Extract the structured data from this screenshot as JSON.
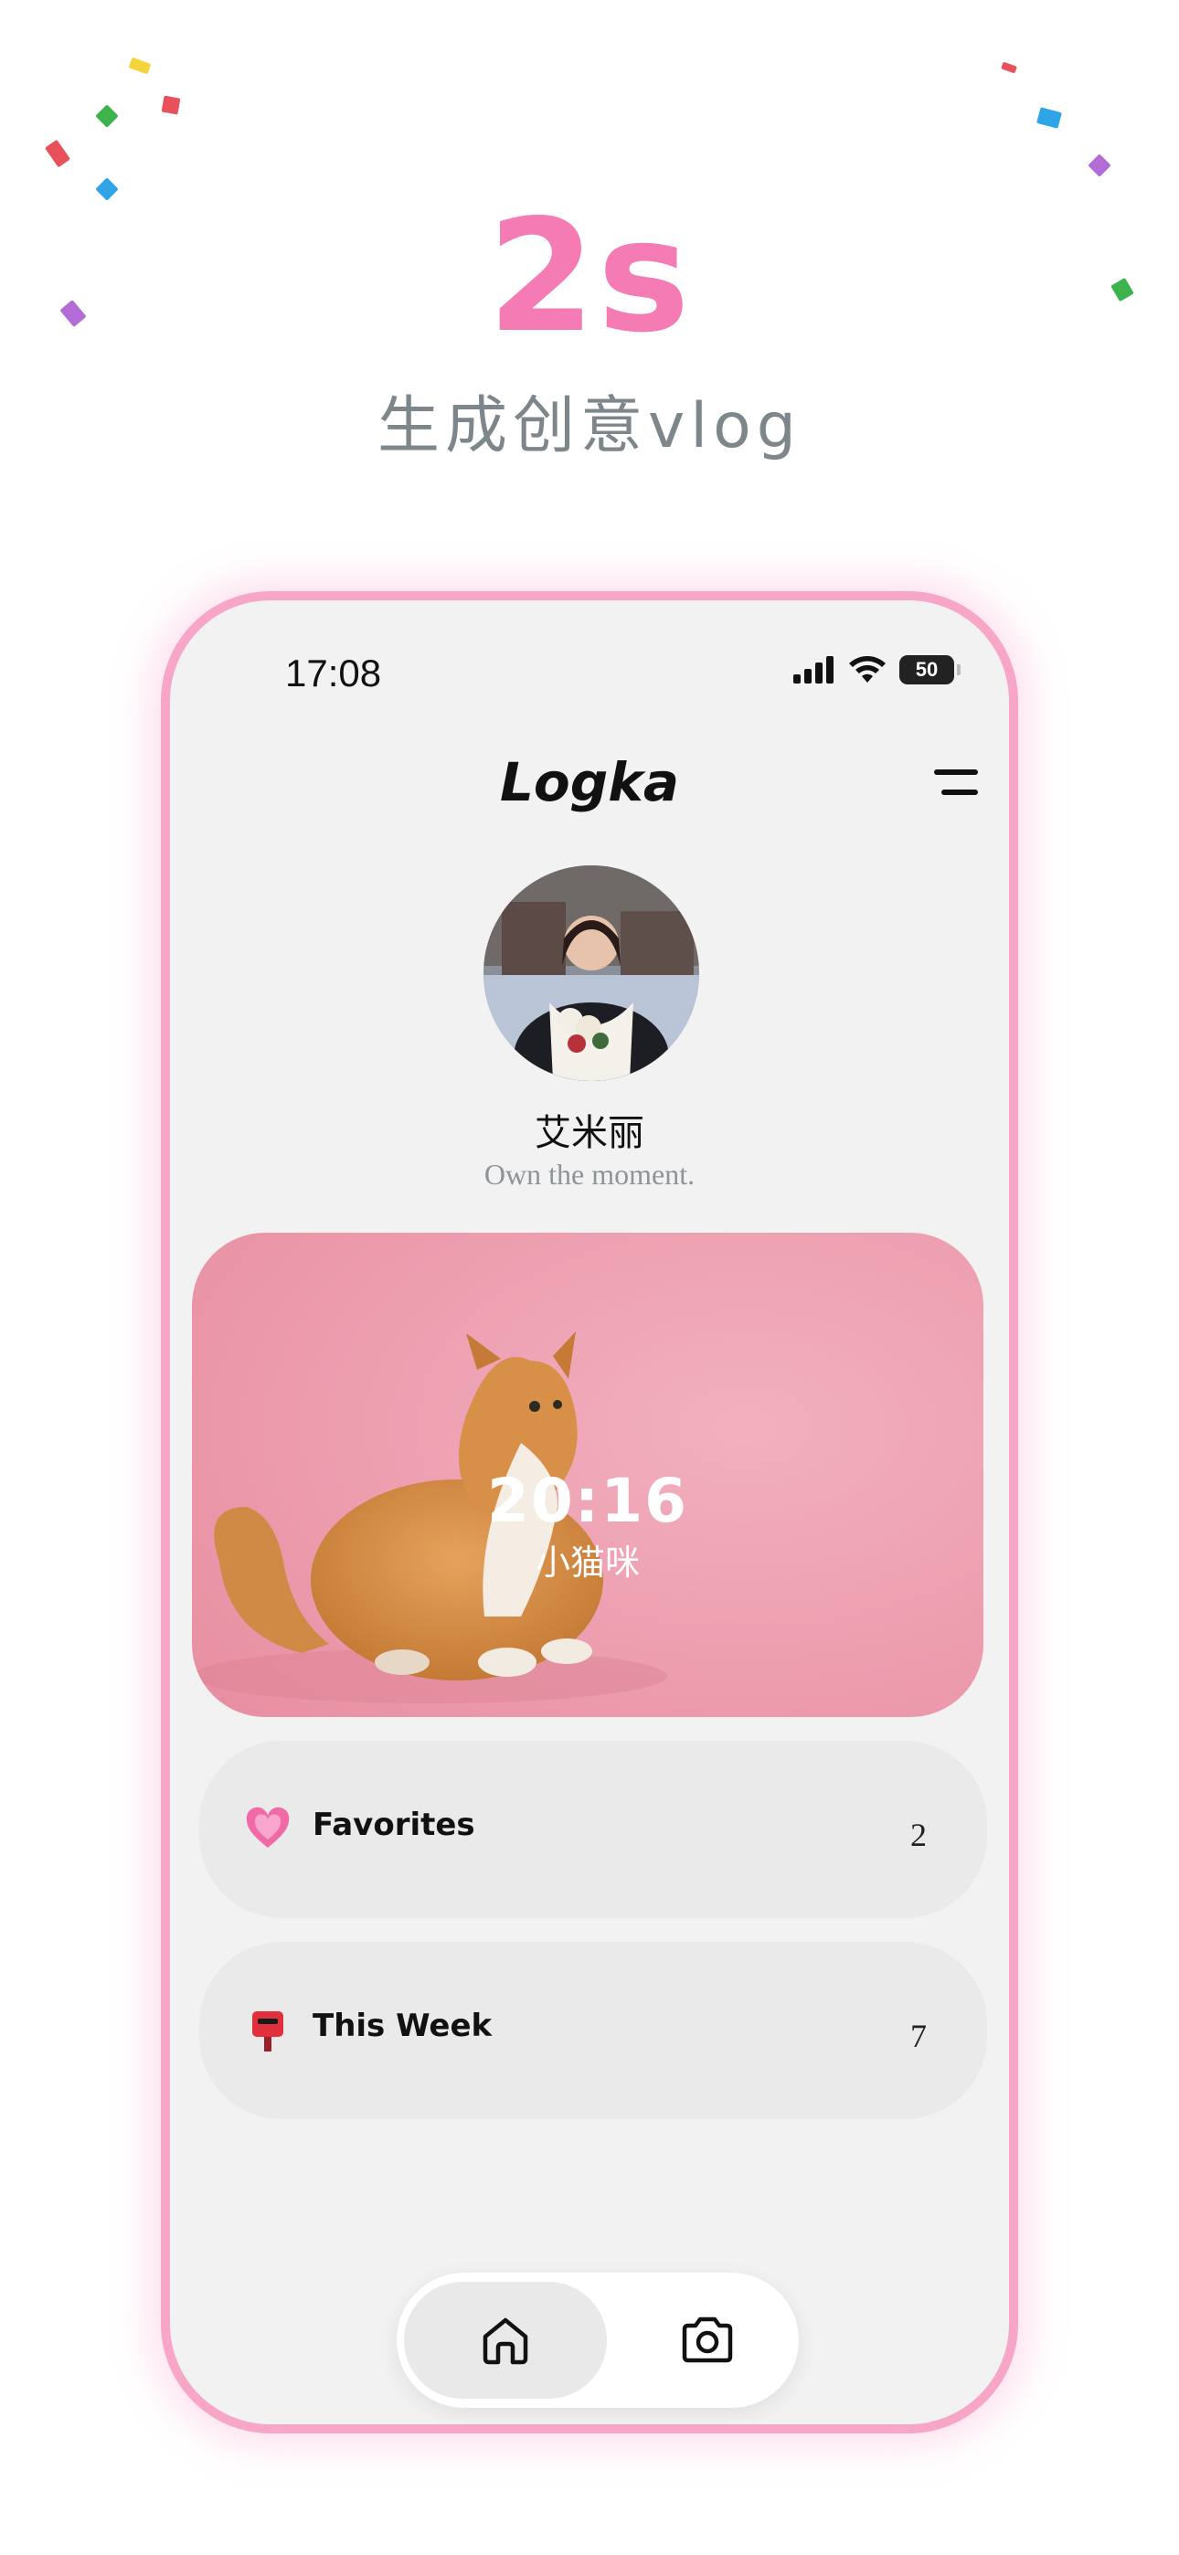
{
  "promo": {
    "headline": "2s",
    "subheadline": "生成创意vlog",
    "colors": {
      "accent": "#f57bb5",
      "subtitle": "#7d868a",
      "frame": "#f8a6c8"
    }
  },
  "status_bar": {
    "time": "17:08",
    "battery": "50",
    "icons": [
      "cellular-signal-icon",
      "wifi-icon",
      "battery-icon"
    ]
  },
  "header": {
    "title": "Logka",
    "menu_icon": "menu-icon"
  },
  "profile": {
    "name": "艾米丽",
    "bio": "Own the moment."
  },
  "featured_card": {
    "time": "20:16",
    "subtitle": "小猫咪",
    "background_color": "#eca4b5"
  },
  "lists": [
    {
      "label": "Favorites",
      "count": "2",
      "icon": "heart-icon"
    },
    {
      "label": "This Week",
      "count": "7",
      "icon": "postbox-icon"
    }
  ],
  "tab_bar": {
    "tabs": [
      {
        "name": "home",
        "icon": "home-icon",
        "selected": true
      },
      {
        "name": "camera",
        "icon": "camera-icon",
        "selected": false
      }
    ]
  }
}
